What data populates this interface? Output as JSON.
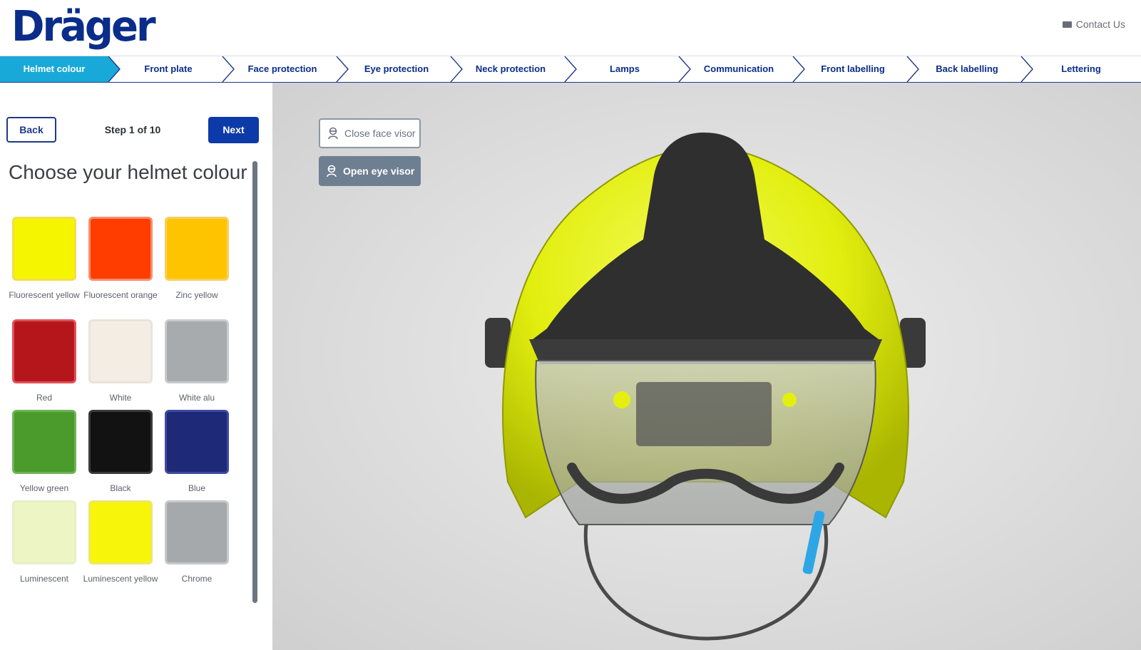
{
  "header": {
    "logo": "Dräger",
    "contact_label": "Contact Us",
    "contact_icon": "mail-icon"
  },
  "steps": [
    {
      "label": "Helmet colour",
      "active": true
    },
    {
      "label": "Front plate",
      "active": false
    },
    {
      "label": "Face protection",
      "active": false
    },
    {
      "label": "Eye protection",
      "active": false
    },
    {
      "label": "Neck protection",
      "active": false
    },
    {
      "label": "Lamps",
      "active": false
    },
    {
      "label": "Communication",
      "active": false
    },
    {
      "label": "Front labelling",
      "active": false
    },
    {
      "label": "Back labelling",
      "active": false
    },
    {
      "label": "Lettering",
      "active": false
    }
  ],
  "panel": {
    "back_label": "Back",
    "step_text": "Step 1 of 10",
    "next_label": "Next",
    "title": "Choose your helmet colour"
  },
  "colours": [
    {
      "label": "Fluorescent yellow",
      "hex": "#f5f500",
      "border": "#f3df4a"
    },
    {
      "label": "Fluorescent orange",
      "hex": "#ff3d00",
      "border": "#f2906d"
    },
    {
      "label": "Zinc yellow",
      "hex": "#ffc400",
      "border": "#f7cf62"
    },
    {
      "label": "Red",
      "hex": "#b5161c",
      "border": "#e05058"
    },
    {
      "label": "White",
      "hex": "#f4ede4",
      "border": "#e9e3dc"
    },
    {
      "label": "White alu",
      "hex": "#a8abad",
      "border": "#c8cacc"
    },
    {
      "label": "Yellow green",
      "hex": "#4a9a2c",
      "border": "#6fb357"
    },
    {
      "label": "Black",
      "hex": "#121212",
      "border": "#3a3a3a"
    },
    {
      "label": "Blue",
      "hex": "#1e2a78",
      "border": "#3e4aa0"
    },
    {
      "label": "Luminescent",
      "hex": "#eef5c4",
      "border": "#e6f0c6"
    },
    {
      "label": "Luminescent yellow",
      "hex": "#f7f50a",
      "border": "#efe66b"
    },
    {
      "label": "Chrome",
      "hex": "#a6a9ab",
      "border": "#c6c8ca"
    }
  ],
  "viewer": {
    "close_face_visor_label": "Close face visor",
    "open_eye_visor_label": "Open eye visor",
    "helmet_colour": "#e4ef10",
    "accent_colour": "#2f2f2f"
  }
}
